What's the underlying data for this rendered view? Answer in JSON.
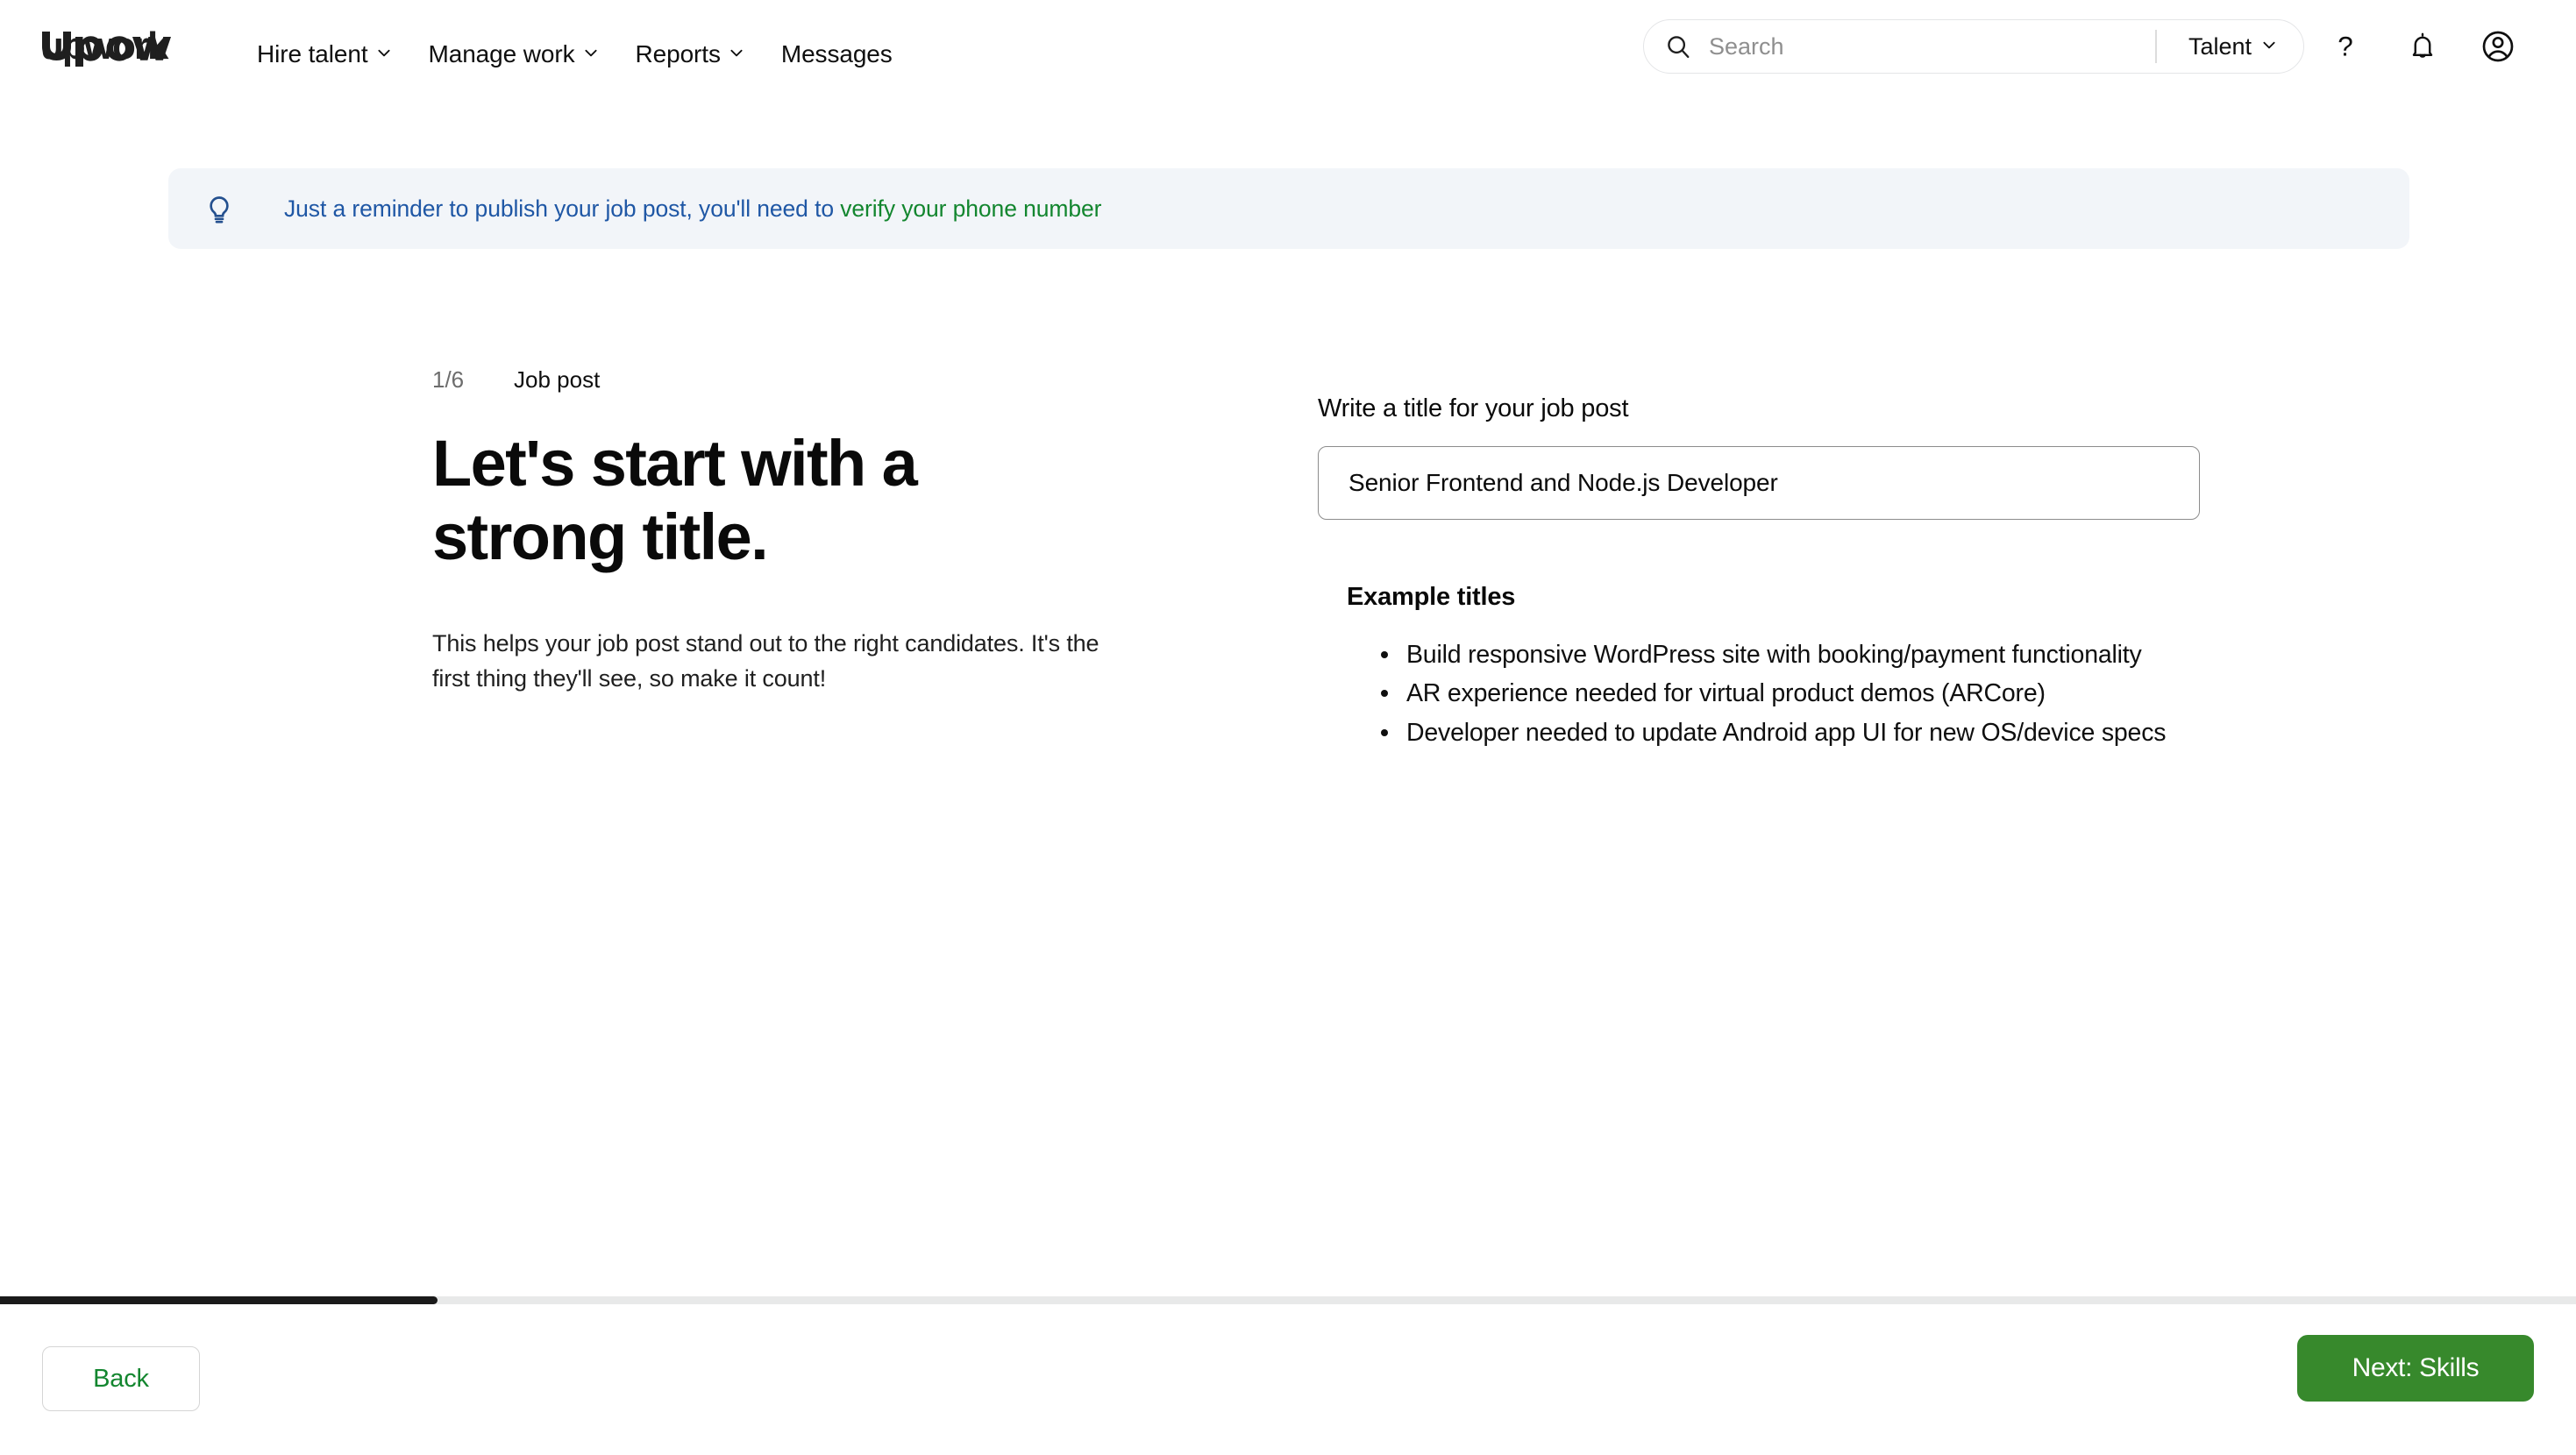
{
  "brand": {
    "logo_text": "upwork",
    "accent_green": "#13862f",
    "button_green": "#37892c",
    "banner_blue": "#1f57a5",
    "banner_bg": "#f2f5f9"
  },
  "nav": {
    "items": [
      {
        "label": "Hire talent",
        "has_dropdown": true
      },
      {
        "label": "Manage work",
        "has_dropdown": true
      },
      {
        "label": "Reports",
        "has_dropdown": true
      },
      {
        "label": "Messages",
        "has_dropdown": false
      }
    ]
  },
  "search": {
    "placeholder": "Search",
    "value": "",
    "scope_label": "Talent",
    "icon": "search-icon"
  },
  "header_icons": [
    {
      "name": "help-icon",
      "glyph": "?"
    },
    {
      "name": "notification-bell-icon",
      "glyph": "bell"
    },
    {
      "name": "account-avatar-icon",
      "glyph": "user-circle"
    }
  ],
  "banner": {
    "icon": "lightbulb-icon",
    "text": "Just a reminder to publish your job post, you'll need to ",
    "link_text": "verify your phone number"
  },
  "wizard": {
    "step_number": "1/6",
    "step_label": "Job post",
    "heading": "Let's start with a strong title.",
    "description": "This helps your job post stand out to the right candidates. It's the first thing they'll see, so make it count!",
    "progress_percent": 17
  },
  "form": {
    "field_label": "Write a title for your job post",
    "title_value": "Senior Frontend and Node.js Developer",
    "title_placeholder": ""
  },
  "examples": {
    "heading": "Example titles",
    "items": [
      "Build responsive WordPress site with booking/payment functionality",
      "AR experience needed for virtual product demos (ARCore)",
      "Developer needed to update Android app UI for new OS/device specs"
    ]
  },
  "footer": {
    "back_label": "Back",
    "next_label": "Next: Skills"
  }
}
